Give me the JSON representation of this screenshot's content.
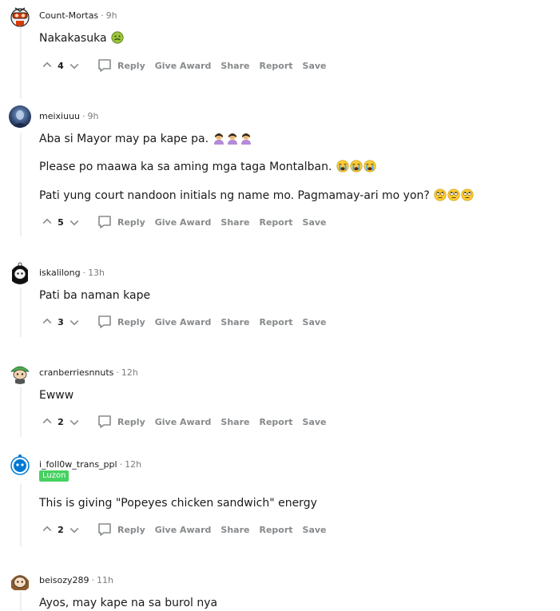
{
  "actions": {
    "reply": "Reply",
    "give_award": "Give Award",
    "share": "Share",
    "report": "Report",
    "save": "Save"
  },
  "comments": [
    {
      "author": "Count-Mortas",
      "time": "9h",
      "avatar": "snoo-avatar-red-goggles",
      "lines": [
        "Nakakasuka"
      ],
      "score": "4"
    },
    {
      "author": "meixiuuu",
      "time": "9h",
      "avatar": "profile-photo",
      "lines": [
        "Aba si Mayor may pa kape pa.",
        "Please po maawa ka sa aming mga taga Montalban.",
        "Pati yung court nandoon initials ng name mo. Pagmamay-ari mo yon?"
      ],
      "score": "5"
    },
    {
      "author": "iskalilong",
      "time": "13h",
      "avatar": "snoo-avatar-black-hair",
      "lines": [
        "Pati ba naman kape"
      ],
      "score": "3"
    },
    {
      "author": "cranberriesnnuts",
      "time": "12h",
      "avatar": "snoo-avatar-green-hat",
      "lines": [
        "Ewww"
      ],
      "score": "2"
    },
    {
      "author": "i_foll0w_trans_ppl",
      "time": "12h",
      "avatar": "snoo-avatar-blue",
      "flair": "Luzon",
      "lines": [
        "This is giving \"Popeyes chicken sandwich\" energy"
      ],
      "score": "2"
    },
    {
      "author": "beisozy289",
      "time": "11h",
      "avatar": "snoo-avatar-brown-hair",
      "lines": [
        "Ayos, may kape na sa burol nya"
      ]
    }
  ],
  "colors": {
    "flair_bg": "#46d160",
    "meta_gray": "#7c7c7c",
    "action_gray": "#878a8c"
  }
}
